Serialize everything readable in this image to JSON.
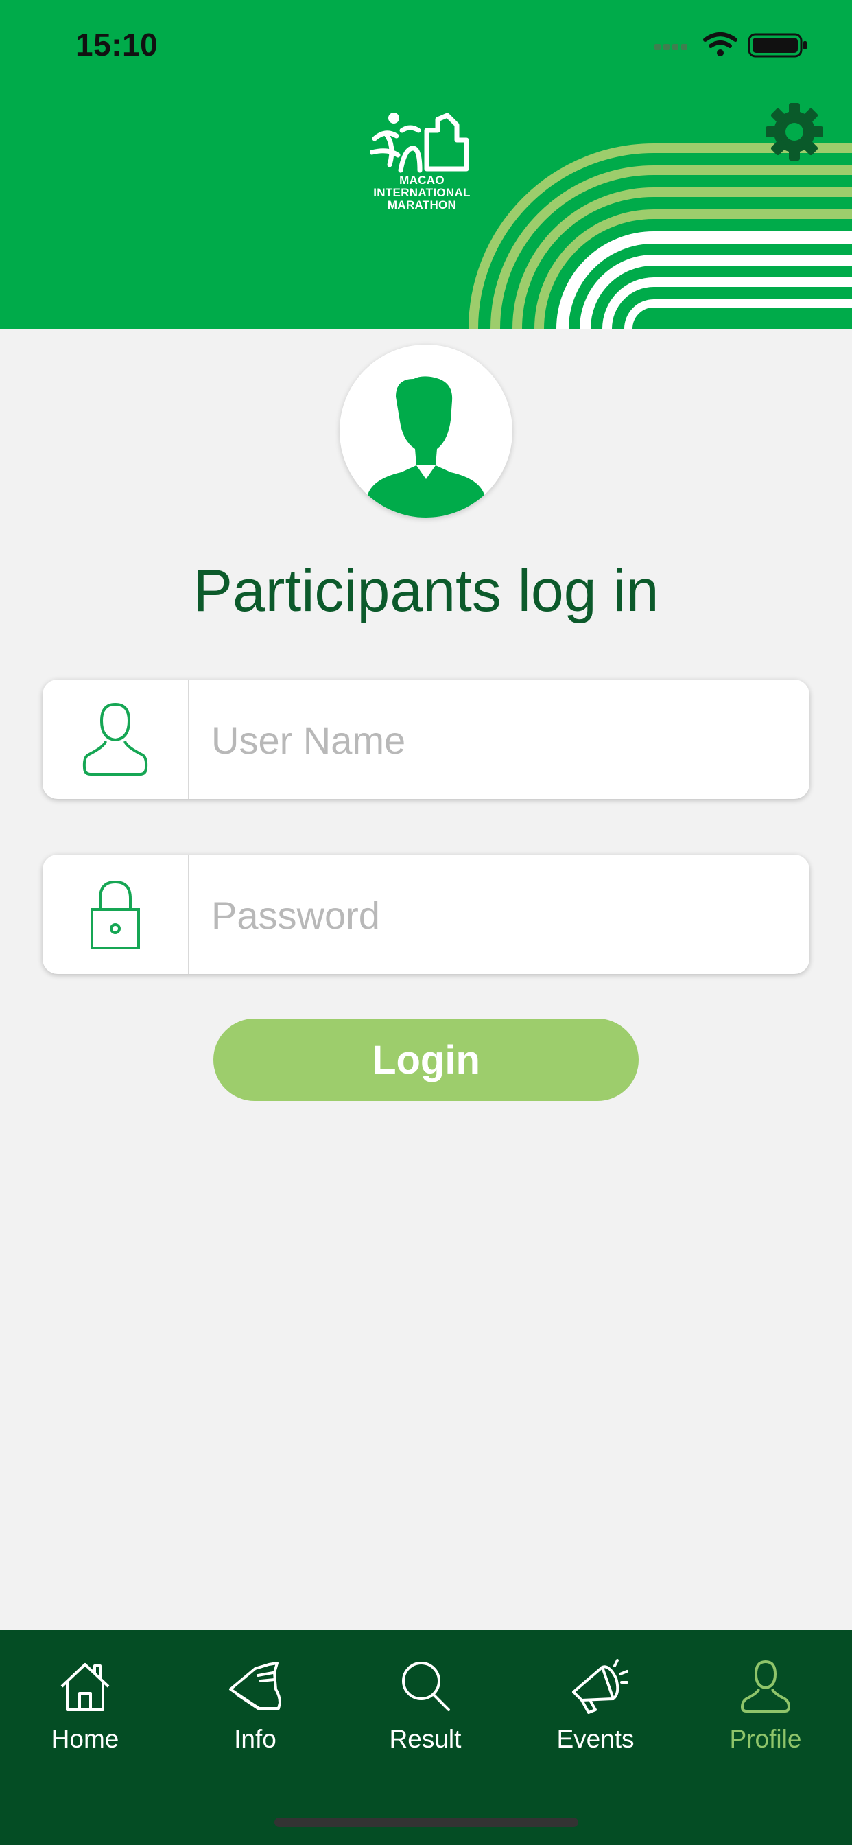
{
  "status_bar": {
    "time": "15:10"
  },
  "header": {
    "logo_lines": [
      "MACAO",
      "INTERNATIONAL",
      "MARATHON"
    ],
    "settings_icon": "gear-icon"
  },
  "login": {
    "title": "Participants log in",
    "username": {
      "placeholder": "User Name",
      "value": "",
      "icon": "user-icon"
    },
    "password": {
      "placeholder": "Password",
      "value": "",
      "icon": "lock-icon"
    },
    "submit_label": "Login"
  },
  "tabbar": {
    "items": [
      {
        "label": "Home",
        "icon": "house-icon"
      },
      {
        "label": "Info",
        "icon": "running-shoe-icon"
      },
      {
        "label": "Result",
        "icon": "magnifier-icon"
      },
      {
        "label": "Events",
        "icon": "megaphone-icon"
      },
      {
        "label": "Profile",
        "icon": "user-icon"
      }
    ],
    "active": "Profile"
  },
  "colors": {
    "header_green": "#00ab4a",
    "title_green": "#0c5a2b",
    "button_green": "#9dcd6c",
    "tabbar_green": "#044d24",
    "active_tab": "#8fc46a"
  }
}
